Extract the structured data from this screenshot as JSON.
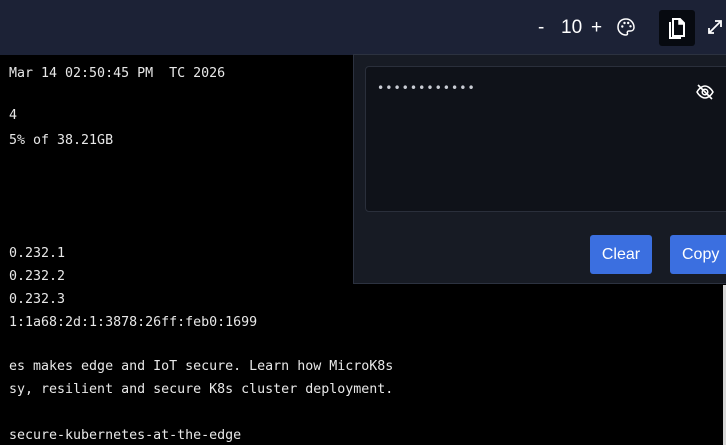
{
  "toolbar": {
    "zoom_minus": "-",
    "zoom_value": "10",
    "zoom_plus": "+",
    "icons": [
      "palette-icon",
      "clipboard-icon",
      "expand-icon"
    ]
  },
  "terminal": {
    "lines": [
      "Mar 14 02:50:45 PM  TC 2026",
      "",
      "4",
      "5% of 38.21GB",
      "",
      "",
      "",
      "",
      "0.232.1",
      "0.232.2",
      "0.232.3",
      "1:1a68:2d:1:3878:26ff:feb0:1699",
      "",
      "es makes edge and IoT secure. Learn how MicroK8s",
      "sy, resilient and secure K8s cluster deployment.",
      "",
      "secure-kubernetes-at-the-edge"
    ]
  },
  "clipboard_panel": {
    "masked_value": "••••••••••••",
    "visibility_icon": "eye-off-icon",
    "clear_label": "Clear",
    "copy_label": "Copy"
  },
  "colors": {
    "toolbar_bg": "#1c2236",
    "panel_bg": "#171b24",
    "button_accent": "#3b6fe0",
    "terminal_bg": "#000000"
  }
}
